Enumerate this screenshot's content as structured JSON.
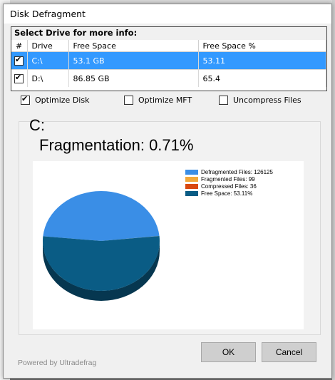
{
  "window": {
    "title": "Disk Defragment"
  },
  "drives": {
    "header": "Select Drive for more info:",
    "columns": [
      "#",
      "Drive",
      "Free Space",
      "Free Space %"
    ],
    "rows": [
      {
        "checked": true,
        "drive": "C:\\",
        "free_space": "53.1 GB",
        "free_pct": "53.11",
        "selected": true
      },
      {
        "checked": true,
        "drive": "D:\\",
        "free_space": "86.85 GB",
        "free_pct": "65.4",
        "selected": false
      }
    ]
  },
  "options": {
    "optimize_disk": {
      "label": "Optimize Disk",
      "checked": true
    },
    "optimize_mft": {
      "label": "Optimize MFT",
      "checked": false
    },
    "uncompress": {
      "label": "Uncompress Files",
      "checked": false
    }
  },
  "details": {
    "drive_letter": "C:",
    "fragmentation": "Fragmentation:  0.71%"
  },
  "chart_data": {
    "type": "pie",
    "labels": [
      "Defragmented Files: 126125",
      "Fragmented Files: 99",
      "Compressed Files: 36",
      "Free Space: 53.11%"
    ],
    "values": [
      46.89,
      0.04,
      0.01,
      53.11
    ],
    "colors": [
      "#3a8ee6",
      "#f2a93b",
      "#d9480f",
      "#0a5c85"
    ]
  },
  "footer": {
    "powered_by": "Powered by Ultradefrag",
    "ok_label": "OK",
    "cancel_label": "Cancel"
  }
}
